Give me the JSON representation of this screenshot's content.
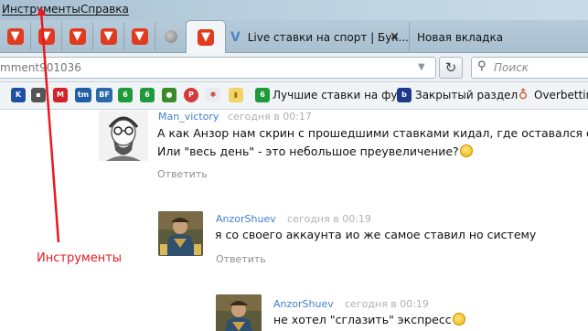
{
  "menu": {
    "items": [
      {
        "label": "Инструменты"
      },
      {
        "label": "Справка"
      }
    ]
  },
  "tabs": {
    "pinned_icons": [
      "opera-logo",
      "opera-logo",
      "opera-logo",
      "opera-logo",
      "opera-logo",
      "globe",
      "opera-logo-active"
    ],
    "tab1_title": "Live ставки на спорт | Бук...",
    "tab1_close": "✕",
    "tab2_title": "Новая вкладка"
  },
  "navbar": {
    "url": "mment901036",
    "search_placeholder": "Поиск"
  },
  "bookmarks": {
    "items": [
      {
        "label": "Лучшие ставки на фу..."
      },
      {
        "label": "Закрытый раздел"
      },
      {
        "label": "Overbetting"
      }
    ]
  },
  "comments": [
    {
      "author": "Man_victory",
      "time": "сегодня в 00:17",
      "line1": "А как Анзор нам скрин с прошедшими ставками кидал, где оставался од",
      "line2": "Или \"весь день\" - это небольшое преувеличение?",
      "reply": "Ответить"
    },
    {
      "author": "AnzorShuev",
      "time": "сегодня в 00:19",
      "line1": "я со своего аккаунта ио же самое ставил но систему",
      "reply": "Ответить"
    },
    {
      "author": "AnzorShuev",
      "time": "сегодня в 00:19",
      "line1": "не хотел \"сглазить\" экспресс"
    }
  ],
  "annotation": {
    "label": "Инструменты",
    "color": "#e8191f"
  }
}
